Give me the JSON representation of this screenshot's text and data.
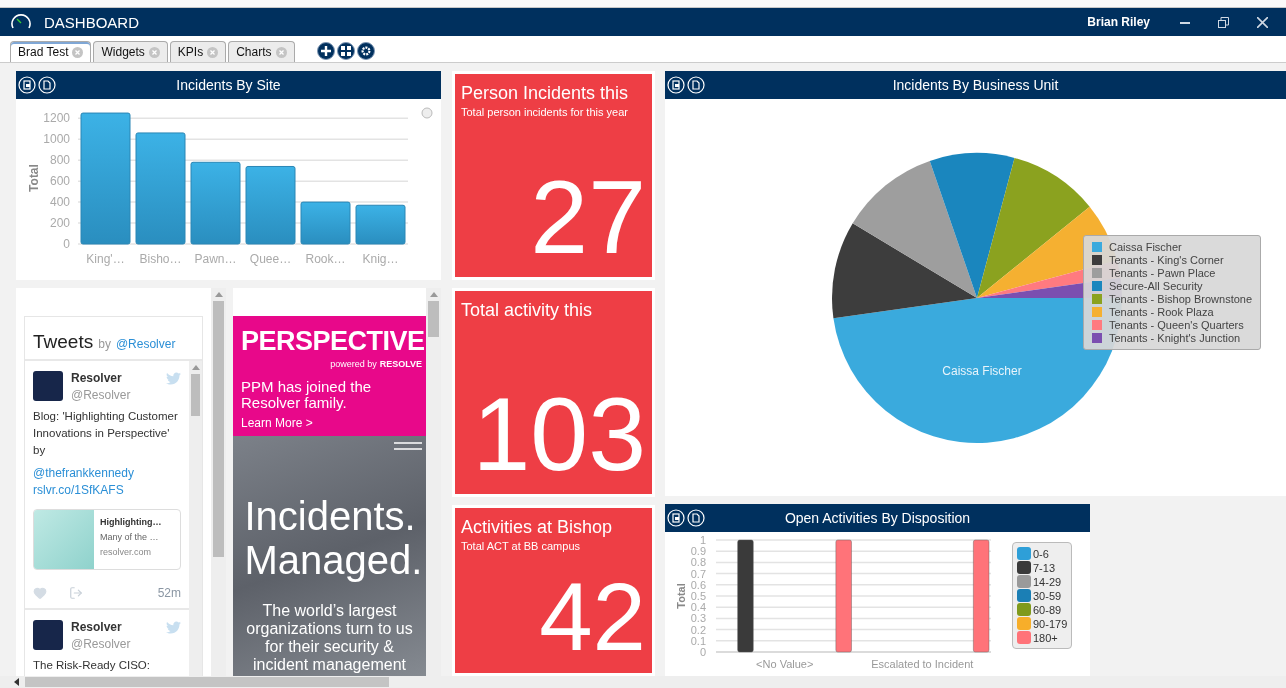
{
  "window": {
    "title": "DASHBOARD",
    "user": "Brian Riley"
  },
  "tabs": [
    {
      "label": "Brad Test",
      "selected": true
    },
    {
      "label": "Widgets",
      "selected": false
    },
    {
      "label": "KPIs",
      "selected": false
    },
    {
      "label": "Charts",
      "selected": false
    }
  ],
  "incidents_by_site": {
    "title": "Incidents By Site",
    "chart_data": {
      "type": "bar",
      "ylabel": "Total",
      "categories": [
        "King'…",
        "Bisho…",
        "Pawn…",
        "Quee…",
        "Rook…",
        "Knig…"
      ],
      "values": [
        1250,
        1060,
        780,
        740,
        400,
        370
      ],
      "grid": true,
      "ylim": [
        0,
        1260
      ],
      "yticks": [
        0,
        200,
        400,
        600,
        800,
        1000,
        1200
      ]
    }
  },
  "twitter_widget": {
    "title": "Tweets",
    "by": "by",
    "handle_link": "@Resolver",
    "tweets": [
      {
        "name": "Resolver",
        "handle": "@Resolver",
        "text": "Blog: 'Highlighting Customer Innovations in Perspective' by",
        "mention": "@thefrankkennedy",
        "link": "rslvr.co/1SfKAFS",
        "card": {
          "title": "Highlighting…",
          "description": "Many of the …",
          "domain": "resolver.com"
        },
        "time": "52m"
      },
      {
        "name": "Resolver",
        "handle": "@Resolver",
        "text": "The Risk-Ready CISO:"
      }
    ]
  },
  "perspective_ad": {
    "logo": "PERSPECTIVE",
    "tagline": "powered by",
    "brand": "RESOLVE",
    "headline": "PPM has joined the Resolver family.",
    "link": "Learn More >",
    "hero_title": "Incidents. Managed.",
    "hero_text": "The world’s largest organizations turn to us for their security & incident management"
  },
  "kpis": [
    {
      "title": "Person Incidents this",
      "subtitle": "Total person incidents for this year",
      "value": "27"
    },
    {
      "title": "Total activity this",
      "value": "103"
    },
    {
      "title": "Activities at Bishop",
      "subtitle": "Total ACT at BB campus",
      "value": "42"
    }
  ],
  "incidents_by_business_unit": {
    "title": "Incidents By Business Unit",
    "slice_label": "Caissa Fischer",
    "legend": [
      {
        "label": "Caissa Fischer",
        "color": "#3aaadd"
      },
      {
        "label": "Tenants - King's Corner",
        "color": "#3d3d3d"
      },
      {
        "label": "Tenants - Pawn Place",
        "color": "#9e9e9e"
      },
      {
        "label": "Secure-All Security",
        "color": "#1a86be"
      },
      {
        "label": "Tenants - Bishop Brownstone",
        "color": "#8ba21f"
      },
      {
        "label": "Tenants - Rook Plaza",
        "color": "#f5b031"
      },
      {
        "label": "Tenants - Queen's Quarters",
        "color": "#ff7a80"
      },
      {
        "label": "Tenants - Knight's Junction",
        "color": "#7b4fb0"
      }
    ]
  },
  "open_activities": {
    "title": "Open Activities By Disposition",
    "chart_data": {
      "type": "bar",
      "ylabel": "Total",
      "categories": [
        "<No Value>",
        "Escalated to Incident"
      ],
      "grid": true,
      "ylim": [
        0,
        1
      ],
      "yticks": [
        0,
        0.1,
        0.2,
        0.3,
        0.4,
        0.5,
        0.6,
        0.7,
        0.8,
        0.9,
        1
      ],
      "series": [
        {
          "name": "0-6",
          "color": "#2e9fd8",
          "values": [
            null,
            null
          ]
        },
        {
          "name": "7-13",
          "color": "#3a3a3a",
          "values": [
            1,
            null
          ]
        },
        {
          "name": "14-29",
          "color": "#9a9a9a",
          "values": [
            null,
            null
          ]
        },
        {
          "name": "30-59",
          "color": "#1b7fb5",
          "values": [
            null,
            null
          ]
        },
        {
          "name": "60-89",
          "color": "#7f9a1c",
          "values": [
            null,
            null
          ]
        },
        {
          "name": "90-179",
          "color": "#f7ae2a",
          "values": [
            null,
            null
          ]
        },
        {
          "name": "180+",
          "color": "#ff7379",
          "values": [
            1,
            1
          ]
        }
      ]
    }
  }
}
